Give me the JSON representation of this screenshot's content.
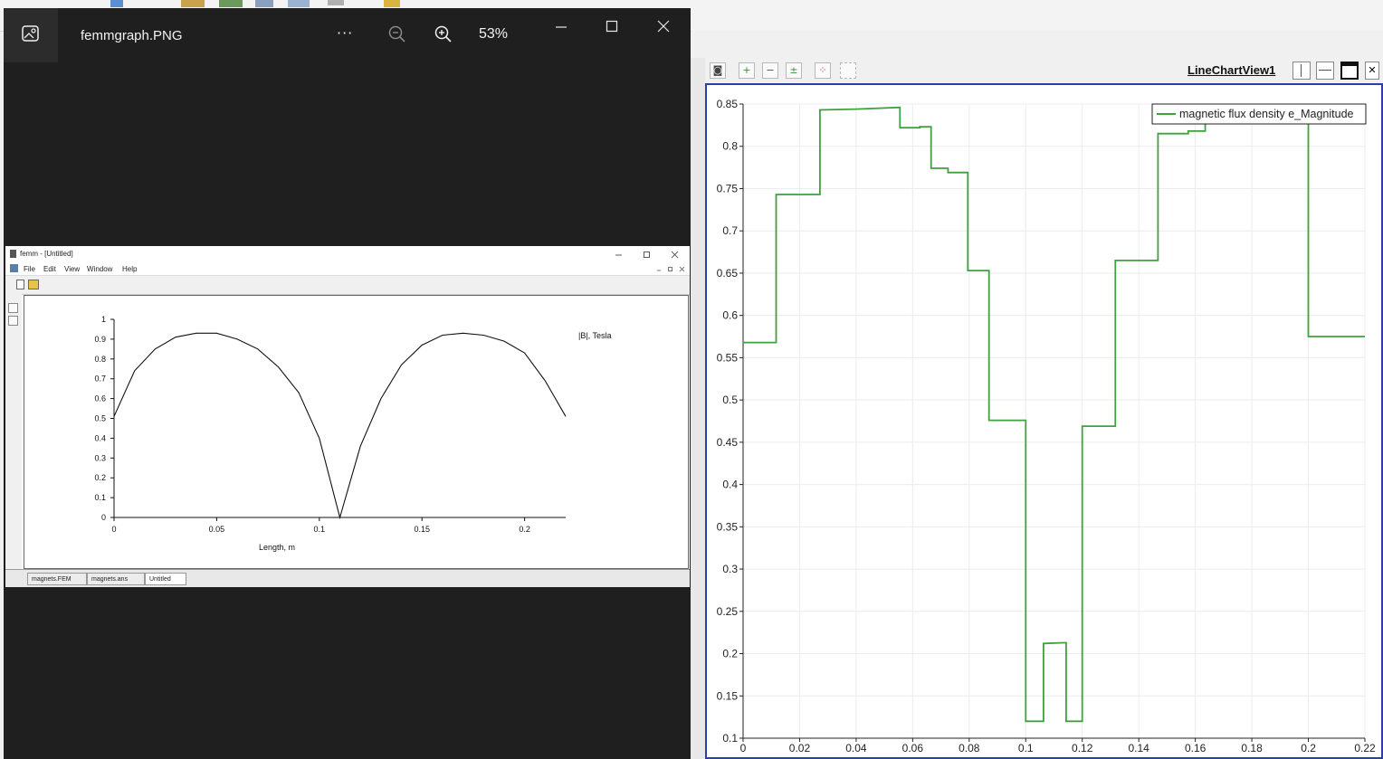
{
  "photos_viewer": {
    "filename": "femmgraph.PNG",
    "more_label": "···",
    "zoom_level": "53%",
    "zoom_out_icon": "zoom-out-icon",
    "zoom_in_icon": "zoom-in-icon"
  },
  "femm_window": {
    "title": "femm - [Untitled]",
    "menu": [
      "File",
      "Edit",
      "View",
      "Window",
      "Help"
    ],
    "tabs": [
      "magnets.FEM",
      "magnets.ans",
      "Untitled"
    ]
  },
  "paraview": {
    "view_title": "LineChartView1"
  },
  "colors": {
    "pv_series": "#3fa13f",
    "femm_line": "#111111",
    "viewer_bg": "#1f1f1f"
  },
  "chart_data": [
    {
      "type": "line",
      "title": "",
      "xlabel": "Length, m",
      "ylabel": "",
      "xlim": [
        0,
        0.22
      ],
      "ylim": [
        0,
        1
      ],
      "xticks": [
        "0",
        "0.05",
        "0.1",
        "0.15",
        "0.2"
      ],
      "yticks": [
        "0",
        "0.1",
        "0.2",
        "0.3",
        "0.4",
        "0.5",
        "0.6",
        "0.7",
        "0.8",
        "0.9",
        "1"
      ],
      "grid": false,
      "annotation": "|B|, Tesla",
      "series": [
        {
          "x": [
            0,
            0.01,
            0.02,
            0.03,
            0.04,
            0.05,
            0.06,
            0.07,
            0.08,
            0.09,
            0.1,
            0.11,
            0.12,
            0.13,
            0.14,
            0.15,
            0.16,
            0.17,
            0.18,
            0.19,
            0.2,
            0.21,
            0.22
          ],
          "y": [
            0.51,
            0.74,
            0.85,
            0.91,
            0.93,
            0.93,
            0.9,
            0.85,
            0.76,
            0.63,
            0.4,
            0.0,
            0.36,
            0.6,
            0.77,
            0.87,
            0.92,
            0.93,
            0.92,
            0.89,
            0.83,
            0.69,
            0.51
          ]
        }
      ]
    },
    {
      "type": "line",
      "title": "",
      "xlabel": "",
      "ylabel": "",
      "xlim": [
        0,
        0.22
      ],
      "ylim": [
        0.1,
        0.85
      ],
      "xticks": [
        "0",
        "0.02",
        "0.04",
        "0.06",
        "0.08",
        "0.1",
        "0.12",
        "0.14",
        "0.16",
        "0.18",
        "0.2",
        "0.22"
      ],
      "yticks": [
        "0.1",
        "0.15",
        "0.2",
        "0.25",
        "0.3",
        "0.35",
        "0.4",
        "0.45",
        "0.5",
        "0.55",
        "0.6",
        "0.65",
        "0.7",
        "0.75",
        "0.8",
        "0.85"
      ],
      "grid": true,
      "legend_position": "top-right",
      "series": [
        {
          "name": "magnetic flux density e_Magnitude",
          "x": [
            0,
            0.0117,
            0.0117,
            0.0267,
            0.0272,
            0.0272,
            0.04,
            0.0555,
            0.0555,
            0.0625,
            0.0625,
            0.0665,
            0.0665,
            0.0725,
            0.0725,
            0.0795,
            0.0795,
            0.087,
            0.087,
            0.1,
            0.1,
            0.1063,
            0.1063,
            0.1143,
            0.1143,
            0.12,
            0.12,
            0.1317,
            0.1317,
            0.1468,
            0.1468,
            0.1575,
            0.1575,
            0.1635,
            0.1635,
            0.2,
            0.2,
            0.2,
            0.2,
            0.2,
            0.2,
            0.2,
            0.2,
            0.22
          ],
          "y": [
            0.568,
            0.568,
            0.743,
            0.743,
            0.743,
            0.843,
            0.844,
            0.846,
            0.822,
            0.822,
            0.823,
            0.823,
            0.774,
            0.774,
            0.769,
            0.769,
            0.653,
            0.653,
            0.476,
            0.476,
            0.12,
            0.12,
            0.212,
            0.213,
            0.12,
            0.12,
            0.469,
            0.469,
            0.665,
            0.665,
            0.815,
            0.815,
            0.818,
            0.818,
            0.83,
            0.83,
            0.83,
            0.83,
            0.73,
            0.73,
            0.575,
            0.575,
            0.575,
            0.575
          ]
        }
      ]
    }
  ]
}
